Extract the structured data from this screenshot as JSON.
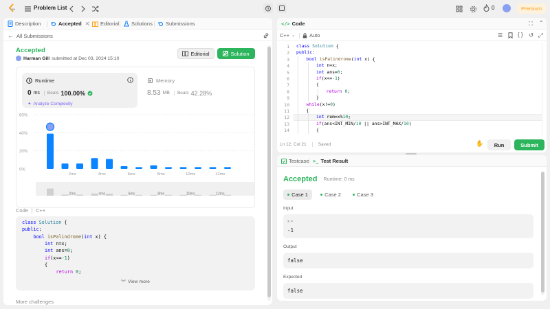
{
  "topbar": {
    "problem_list": "Problem List",
    "streak": "0",
    "premium": "Premium"
  },
  "left_tabs": {
    "description": "Description",
    "accepted": "Accepted",
    "editorial": "Editorial",
    "solutions": "Solutions",
    "submissions": "Submissions"
  },
  "submission": {
    "back_label": "All Submissions",
    "status": "Accepted",
    "user": "Harman Gill",
    "submitted_text": "submitted at Dec 03, 2024 15:10",
    "editorial_btn": "Editorial",
    "solution_btn": "Solution",
    "runtime_label": "Runtime",
    "runtime_value": "0",
    "runtime_unit": "ms",
    "beats_label": "Beats",
    "runtime_beats": "100.00%",
    "analyze": "Analyze Complexity",
    "memory_label": "Memory",
    "memory_value": "8.53",
    "memory_unit": "MB",
    "memory_beats": "42.28%",
    "code_label": "Code",
    "lang": "C++",
    "view_more": "View more",
    "more_challenges": "More challenges"
  },
  "chart_data": {
    "type": "bar",
    "yticks": [
      "60%",
      "40%",
      "20%",
      "0%"
    ],
    "ylim": [
      0,
      60
    ],
    "values": [
      39,
      6,
      6,
      12,
      11,
      3,
      2,
      4,
      2,
      2,
      2,
      2,
      2
    ],
    "highlight_index": 0,
    "xtick_labels": [
      "2ms",
      "4ms",
      "6ms",
      "8ms",
      "10ms",
      "12ms"
    ],
    "xtick_positions": [
      2,
      4,
      6,
      8,
      10,
      12
    ]
  },
  "code_panel": {
    "title": "Code",
    "lang": "C++",
    "auto": "Auto",
    "status": "Ln 12, Col 21",
    "saved": "Saved",
    "run": "Run",
    "submit": "Submit"
  },
  "editor_lines": [
    {
      "n": "1",
      "indent": 0,
      "tokens": [
        [
          "kw",
          "class "
        ],
        [
          "cl",
          "Solution "
        ],
        [
          "pl",
          "{"
        ]
      ]
    },
    {
      "n": "2",
      "indent": 0,
      "tokens": [
        [
          "kw",
          "public"
        ],
        [
          "pl",
          ":"
        ]
      ]
    },
    {
      "n": "3",
      "indent": 1,
      "tokens": [
        [
          "kw",
          "bool "
        ],
        [
          "fn",
          "isPalindrome"
        ],
        [
          "pl",
          "("
        ],
        [
          "kw",
          "int "
        ],
        [
          "pl",
          "x) {"
        ]
      ]
    },
    {
      "n": "4",
      "indent": 2,
      "tokens": [
        [
          "kw",
          "int "
        ],
        [
          "pl",
          "n=x;"
        ]
      ]
    },
    {
      "n": "5",
      "indent": 2,
      "tokens": [
        [
          "kw",
          "int "
        ],
        [
          "pl",
          "ans="
        ],
        [
          "num",
          "0"
        ],
        [
          "pl",
          ";"
        ]
      ]
    },
    {
      "n": "6",
      "indent": 2,
      "tokens": [
        [
          "ctl",
          "if"
        ],
        [
          "pl",
          "(x<="
        ],
        [
          "num",
          "-1"
        ],
        [
          "pl",
          ")"
        ]
      ]
    },
    {
      "n": "7",
      "indent": 2,
      "tokens": [
        [
          "pl",
          "{"
        ]
      ]
    },
    {
      "n": "8",
      "indent": 3,
      "tokens": [
        [
          "ctl",
          "return "
        ],
        [
          "num",
          "0"
        ],
        [
          "pl",
          ";"
        ]
      ]
    },
    {
      "n": "9",
      "indent": 2,
      "tokens": [
        [
          "pl",
          "}"
        ]
      ]
    },
    {
      "n": "10",
      "indent": 1,
      "tokens": [
        [
          "ctl",
          "while"
        ],
        [
          "pl",
          "(x!="
        ],
        [
          "num",
          "0"
        ],
        [
          "pl",
          ")"
        ]
      ]
    },
    {
      "n": "11",
      "indent": 1,
      "tokens": [
        [
          "pl",
          "{"
        ]
      ]
    },
    {
      "n": "12",
      "indent": 2,
      "tokens": [
        [
          "kw",
          "int "
        ],
        [
          "pl",
          "rem=x%"
        ],
        [
          "num",
          "10"
        ],
        [
          "pl",
          ";"
        ]
      ]
    },
    {
      "n": "13",
      "indent": 2,
      "tokens": [
        [
          "ctl",
          "if"
        ],
        [
          "pl",
          "(ans<INT_MIN/"
        ],
        [
          "num",
          "10"
        ],
        [
          "pl",
          " || ans>INT_MAX/"
        ],
        [
          "num",
          "10"
        ],
        [
          "pl",
          ")"
        ]
      ]
    },
    {
      "n": "14",
      "indent": 2,
      "tokens": [
        [
          "pl",
          "{"
        ]
      ]
    }
  ],
  "snippet_lines": [
    {
      "indent": 0,
      "tokens": [
        [
          "kw",
          "class "
        ],
        [
          "cl",
          "Solution "
        ],
        [
          "pl",
          "{"
        ]
      ]
    },
    {
      "indent": 0,
      "tokens": [
        [
          "kw",
          "public"
        ],
        [
          "pl",
          ":"
        ]
      ]
    },
    {
      "indent": 1,
      "tokens": [
        [
          "kw",
          "bool "
        ],
        [
          "fn",
          "isPalindrome"
        ],
        [
          "pl",
          "("
        ],
        [
          "kw",
          "int "
        ],
        [
          "pl",
          "x) {"
        ]
      ]
    },
    {
      "indent": 2,
      "tokens": [
        [
          "kw",
          "int "
        ],
        [
          "pl",
          "n=x;"
        ]
      ]
    },
    {
      "indent": 2,
      "tokens": [
        [
          "kw",
          "int "
        ],
        [
          "pl",
          "ans="
        ],
        [
          "num",
          "0"
        ],
        [
          "pl",
          ";"
        ]
      ]
    },
    {
      "indent": 2,
      "tokens": [
        [
          "ctl",
          "if"
        ],
        [
          "pl",
          "(x<="
        ],
        [
          "num",
          "-1"
        ],
        [
          "pl",
          ")"
        ]
      ]
    },
    {
      "indent": 2,
      "tokens": [
        [
          "pl",
          "{"
        ]
      ]
    },
    {
      "indent": 3,
      "tokens": [
        [
          "ctl",
          "return "
        ],
        [
          "num",
          "0"
        ],
        [
          "pl",
          ";"
        ]
      ]
    }
  ],
  "test_tabs": {
    "testcase": "Testcase",
    "result": "Test Result"
  },
  "result": {
    "status": "Accepted",
    "runtime": "Runtime: 0 ms",
    "cases": [
      "Case 1",
      "Case 2",
      "Case 3"
    ],
    "input_label": "Input",
    "var_name": "x =",
    "input_value": "-1",
    "output_label": "Output",
    "output_value": "false",
    "expected_label": "Expected",
    "expected_value": "false"
  },
  "colors": {
    "accent_green": "#2db55d",
    "bar_blue": "#0a84ff",
    "premium": "#ffa116"
  }
}
